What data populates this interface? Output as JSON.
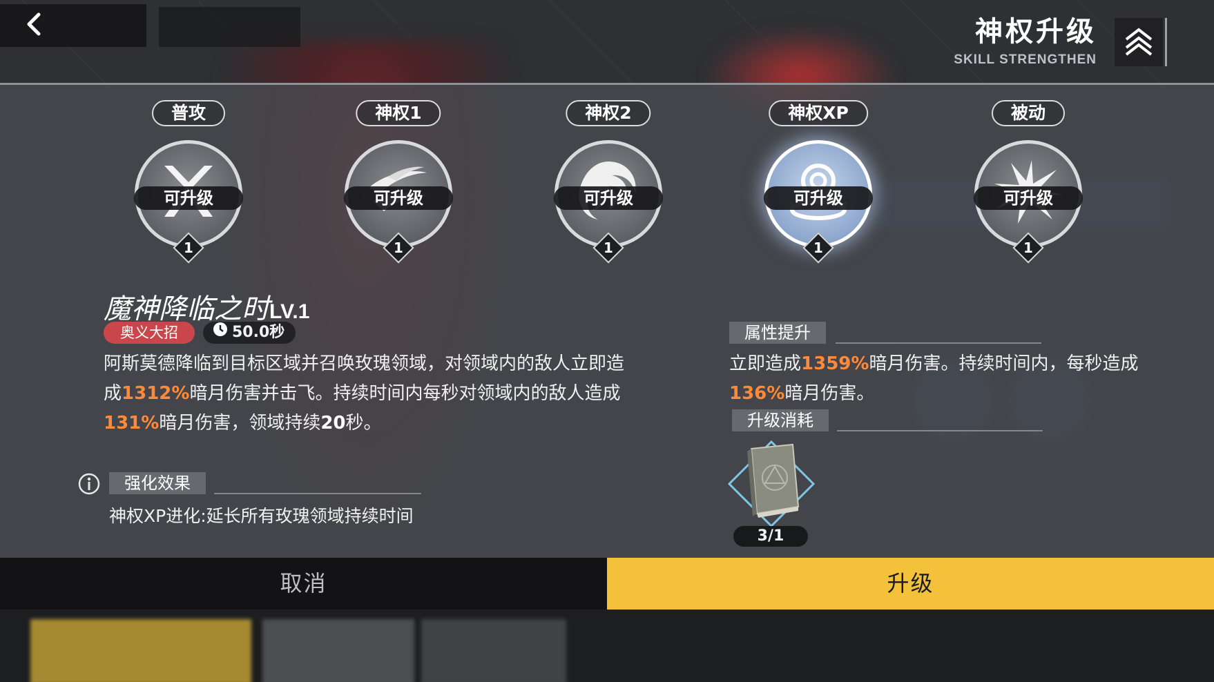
{
  "header": {
    "title": "神权升级",
    "subtitle": "SKILL STRENGTHEN"
  },
  "skills": [
    {
      "label": "普攻",
      "status": "可升级",
      "level": "1",
      "icon": "crossed-blades-icon",
      "active": false
    },
    {
      "label": "神权1",
      "status": "可升级",
      "level": "1",
      "icon": "wind-slash-icon",
      "active": false
    },
    {
      "label": "神权2",
      "status": "可升级",
      "level": "1",
      "icon": "vortex-icon",
      "active": false
    },
    {
      "label": "神权XP",
      "status": "可升级",
      "level": "1",
      "icon": "rose-domain-icon",
      "active": true
    },
    {
      "label": "被动",
      "status": "可升级",
      "level": "1",
      "icon": "burst-icon",
      "active": false
    }
  ],
  "detail": {
    "name": "魔神降临之时",
    "level": "LV.1",
    "tag": "奥义大招",
    "cooldown": "50.0秒",
    "desc": {
      "p1": "阿斯莫德降临到目标区域并召唤玫瑰领域，对领域内的敌人立即造成",
      "v1": "1312%",
      "p2": "暗月伤害并击飞。持续时间内每秒对领域内的敌人造成",
      "v2": "131%",
      "p3": "暗月伤害，领域持续",
      "v3": "20",
      "p4": "秒。"
    }
  },
  "enhance": {
    "heading": "强化效果",
    "text": "神权XP进化:延长所有玫瑰领域持续时间"
  },
  "attr": {
    "heading": "属性提升",
    "p1": "立即造成",
    "v1": "1359%",
    "p2": "暗月伤害。持续时间内，每秒造成",
    "v2": "136%",
    "p3": "暗月伤害。"
  },
  "cost": {
    "heading": "升级消耗",
    "item_icon": "skill-book-icon",
    "count": "3/1"
  },
  "buttons": {
    "cancel": "取消",
    "upgrade": "升级"
  },
  "colors": {
    "highlight": "#ff8a3a",
    "upgrade_button": "#f3c13a",
    "ult_tag": "#c9474a"
  }
}
